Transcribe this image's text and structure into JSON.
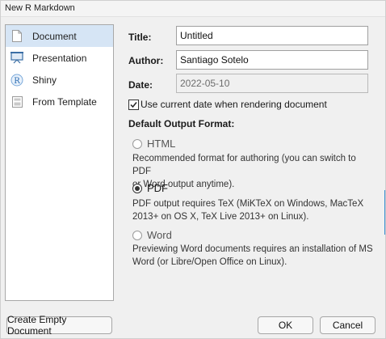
{
  "window": {
    "title": "New R Markdown"
  },
  "sidebar": {
    "items": [
      {
        "label": "Document",
        "icon": "document-icon",
        "selected": true
      },
      {
        "label": "Presentation",
        "icon": "presentation-icon",
        "selected": false
      },
      {
        "label": "Shiny",
        "icon": "shiny-r-icon",
        "selected": false
      },
      {
        "label": "From Template",
        "icon": "template-icon",
        "selected": false
      }
    ]
  },
  "form": {
    "title_label": "Title:",
    "title_value": "Untitled",
    "author_label": "Author:",
    "author_value": "Santiago Sotelo",
    "date_label": "Date:",
    "date_value": "2022-05-10",
    "use_current_date_label": "Use current date when rendering document",
    "use_current_date_checked": true
  },
  "output": {
    "heading": "Default Output Format:",
    "options": [
      {
        "label": "HTML",
        "selected": false,
        "desc": [
          "Recommended format for authoring (you can switch to PDF",
          "or Word output anytime)."
        ]
      },
      {
        "label": "PDF",
        "selected": true,
        "desc": [
          "PDF output requires TeX (MiKTeX on Windows, MacTeX",
          "2013+ on OS X, TeX Live 2013+ on Linux)."
        ]
      },
      {
        "label": "Word",
        "selected": false,
        "desc": [
          "Previewing Word documents requires an installation of MS",
          "Word (or Libre/Open Office on Linux)."
        ]
      }
    ]
  },
  "buttons": {
    "create_empty": "Create Empty Document",
    "ok": "OK",
    "cancel": "Cancel"
  }
}
